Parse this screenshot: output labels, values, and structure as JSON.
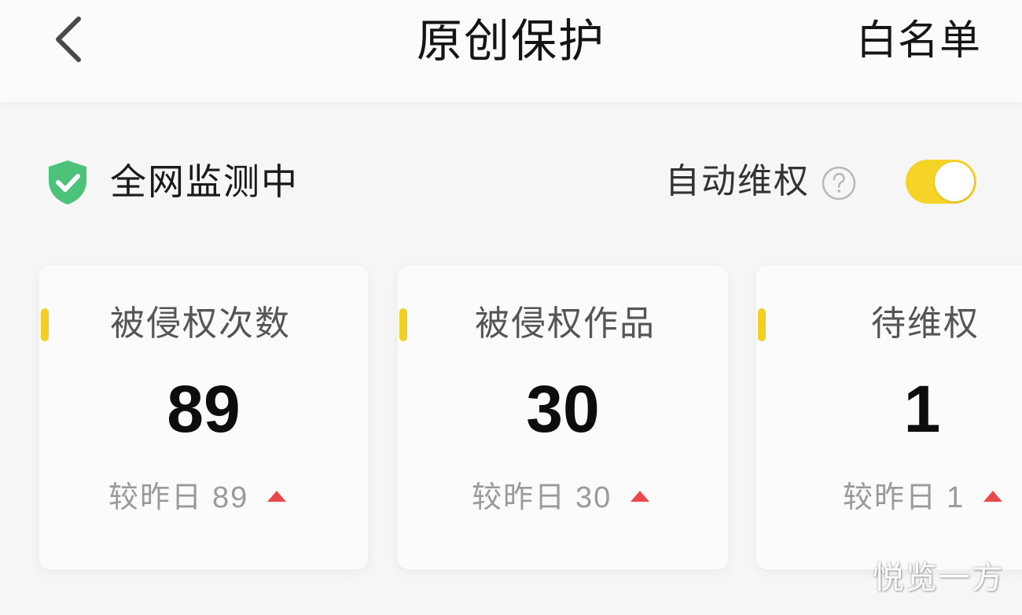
{
  "header": {
    "title": "原创保护",
    "right_action": "白名单",
    "back_icon": "chevron-left-icon"
  },
  "monitor": {
    "status_text": "全网监测中",
    "status_icon": "shield-check-icon",
    "shield_color": "#4cc27a",
    "auto_label": "自动维权",
    "help_icon": "question-circle-icon",
    "auto_enabled": true,
    "toggle_color": "#f6d327"
  },
  "stats": [
    {
      "label": "被侵权次数",
      "value": "89",
      "compare_prefix": "较昨日",
      "compare_value": "89",
      "trend": "up"
    },
    {
      "label": "被侵权作品",
      "value": "30",
      "compare_prefix": "较昨日",
      "compare_value": "30",
      "trend": "up"
    },
    {
      "label": "待维权",
      "value": "1",
      "compare_prefix": "较昨日",
      "compare_value": "1",
      "trend": "up"
    }
  ],
  "colors": {
    "accent": "#f3cf26",
    "trend_up": "#e84a4a"
  },
  "watermark": "悦览一方"
}
